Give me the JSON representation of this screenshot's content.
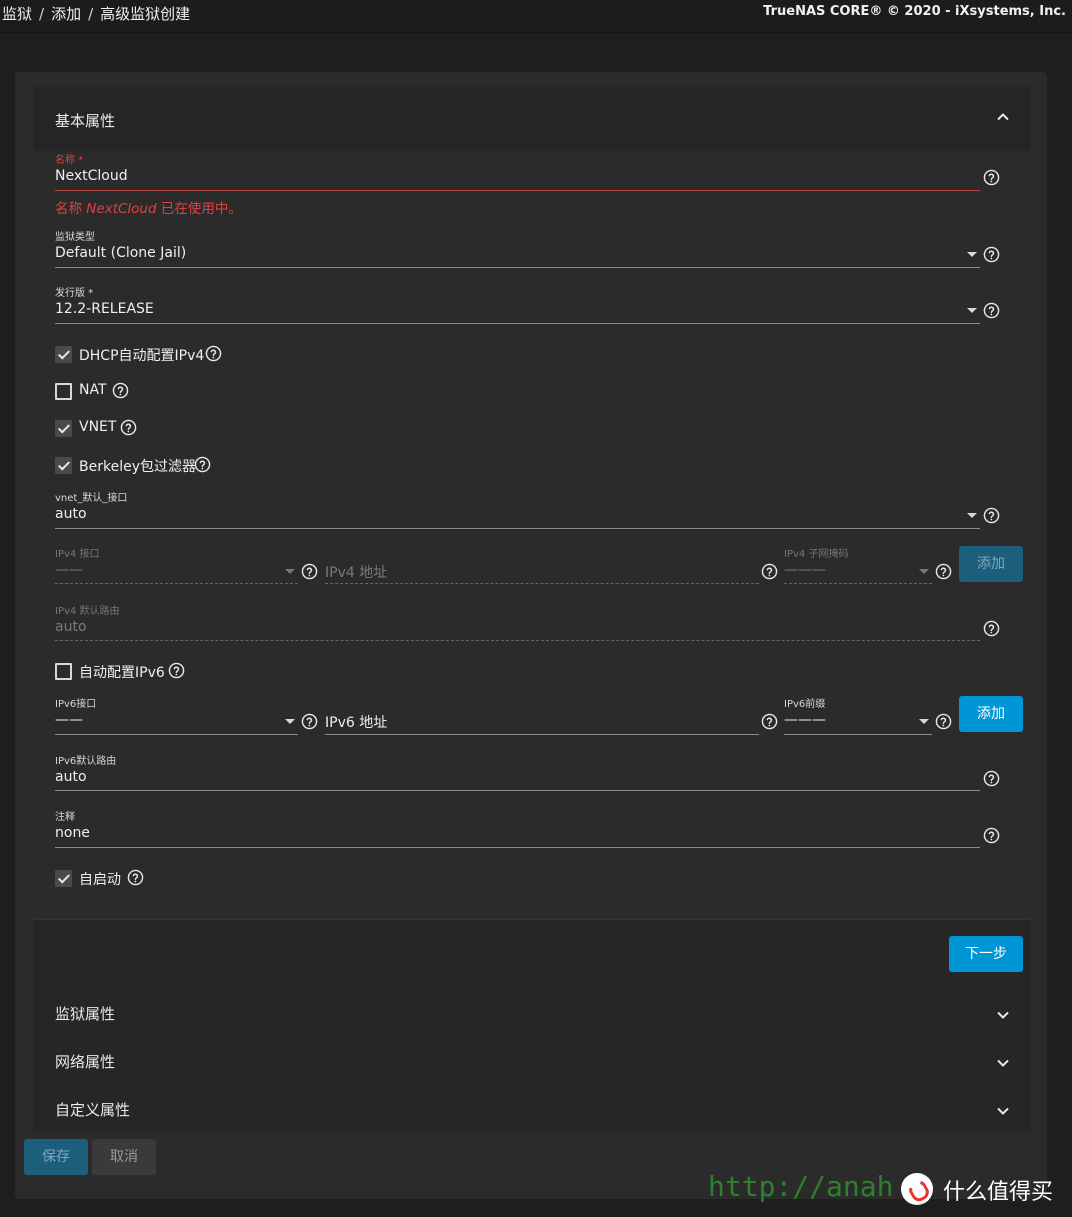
{
  "breadcrumb": [
    "监狱",
    "添加",
    "高级监狱创建"
  ],
  "copyright": "TrueNAS CORE® © 2020 - iXsystems, Inc.",
  "panels": {
    "basic": "基本属性",
    "jail": "监狱属性",
    "network": "网络属性",
    "custom": "自定义属性"
  },
  "form": {
    "name": {
      "label": "名称 *",
      "value": "NextCloud",
      "error_prefix": "名称 ",
      "error_name": "NextCloud",
      "error_suffix": " 已在使用中。"
    },
    "jail_type": {
      "label": "监狱类型",
      "value": "Default (Clone Jail)"
    },
    "release": {
      "label": "发行版 *",
      "value": "12.2-RELEASE"
    },
    "dhcp": {
      "label": "DHCP自动配置IPv4",
      "checked": true
    },
    "nat": {
      "label": "NAT",
      "checked": false
    },
    "vnet": {
      "label": "VNET",
      "checked": true
    },
    "bpf": {
      "label": "Berkeley包过滤器",
      "checked": true
    },
    "vnet_iface": {
      "label": "vnet_默认_接口",
      "value": "auto"
    },
    "ipv4_iface": {
      "label": "IPv4 接口",
      "value": "——"
    },
    "ipv4_addr": {
      "placeholder": "IPv4 地址"
    },
    "ipv4_mask": {
      "label": "IPv4 子网掩码",
      "value": "———"
    },
    "ipv4_add": "添加",
    "ipv4_route": {
      "label": "IPv4 默认路由",
      "value": "auto"
    },
    "auto_ipv6": {
      "label": "自动配置IPv6",
      "checked": false
    },
    "ipv6_iface": {
      "label": "IPv6接口",
      "value": "——"
    },
    "ipv6_addr": {
      "placeholder": "IPv6 地址"
    },
    "ipv6_prefix": {
      "label": "IPv6前缀",
      "value": "———"
    },
    "ipv6_add": "添加",
    "ipv6_route": {
      "label": "IPv6默认路由",
      "value": "auto"
    },
    "notes": {
      "label": "注释",
      "value": "none"
    },
    "autostart": {
      "label": "自启动",
      "checked": true
    }
  },
  "buttons": {
    "next": "下一步",
    "save": "保存",
    "cancel": "取消"
  },
  "watermark": {
    "url": "http://anah",
    "brand": "什么值得买"
  },
  "colors": {
    "accent": "#0095d5",
    "error": "#e04040",
    "background": "#1e1e1e"
  }
}
